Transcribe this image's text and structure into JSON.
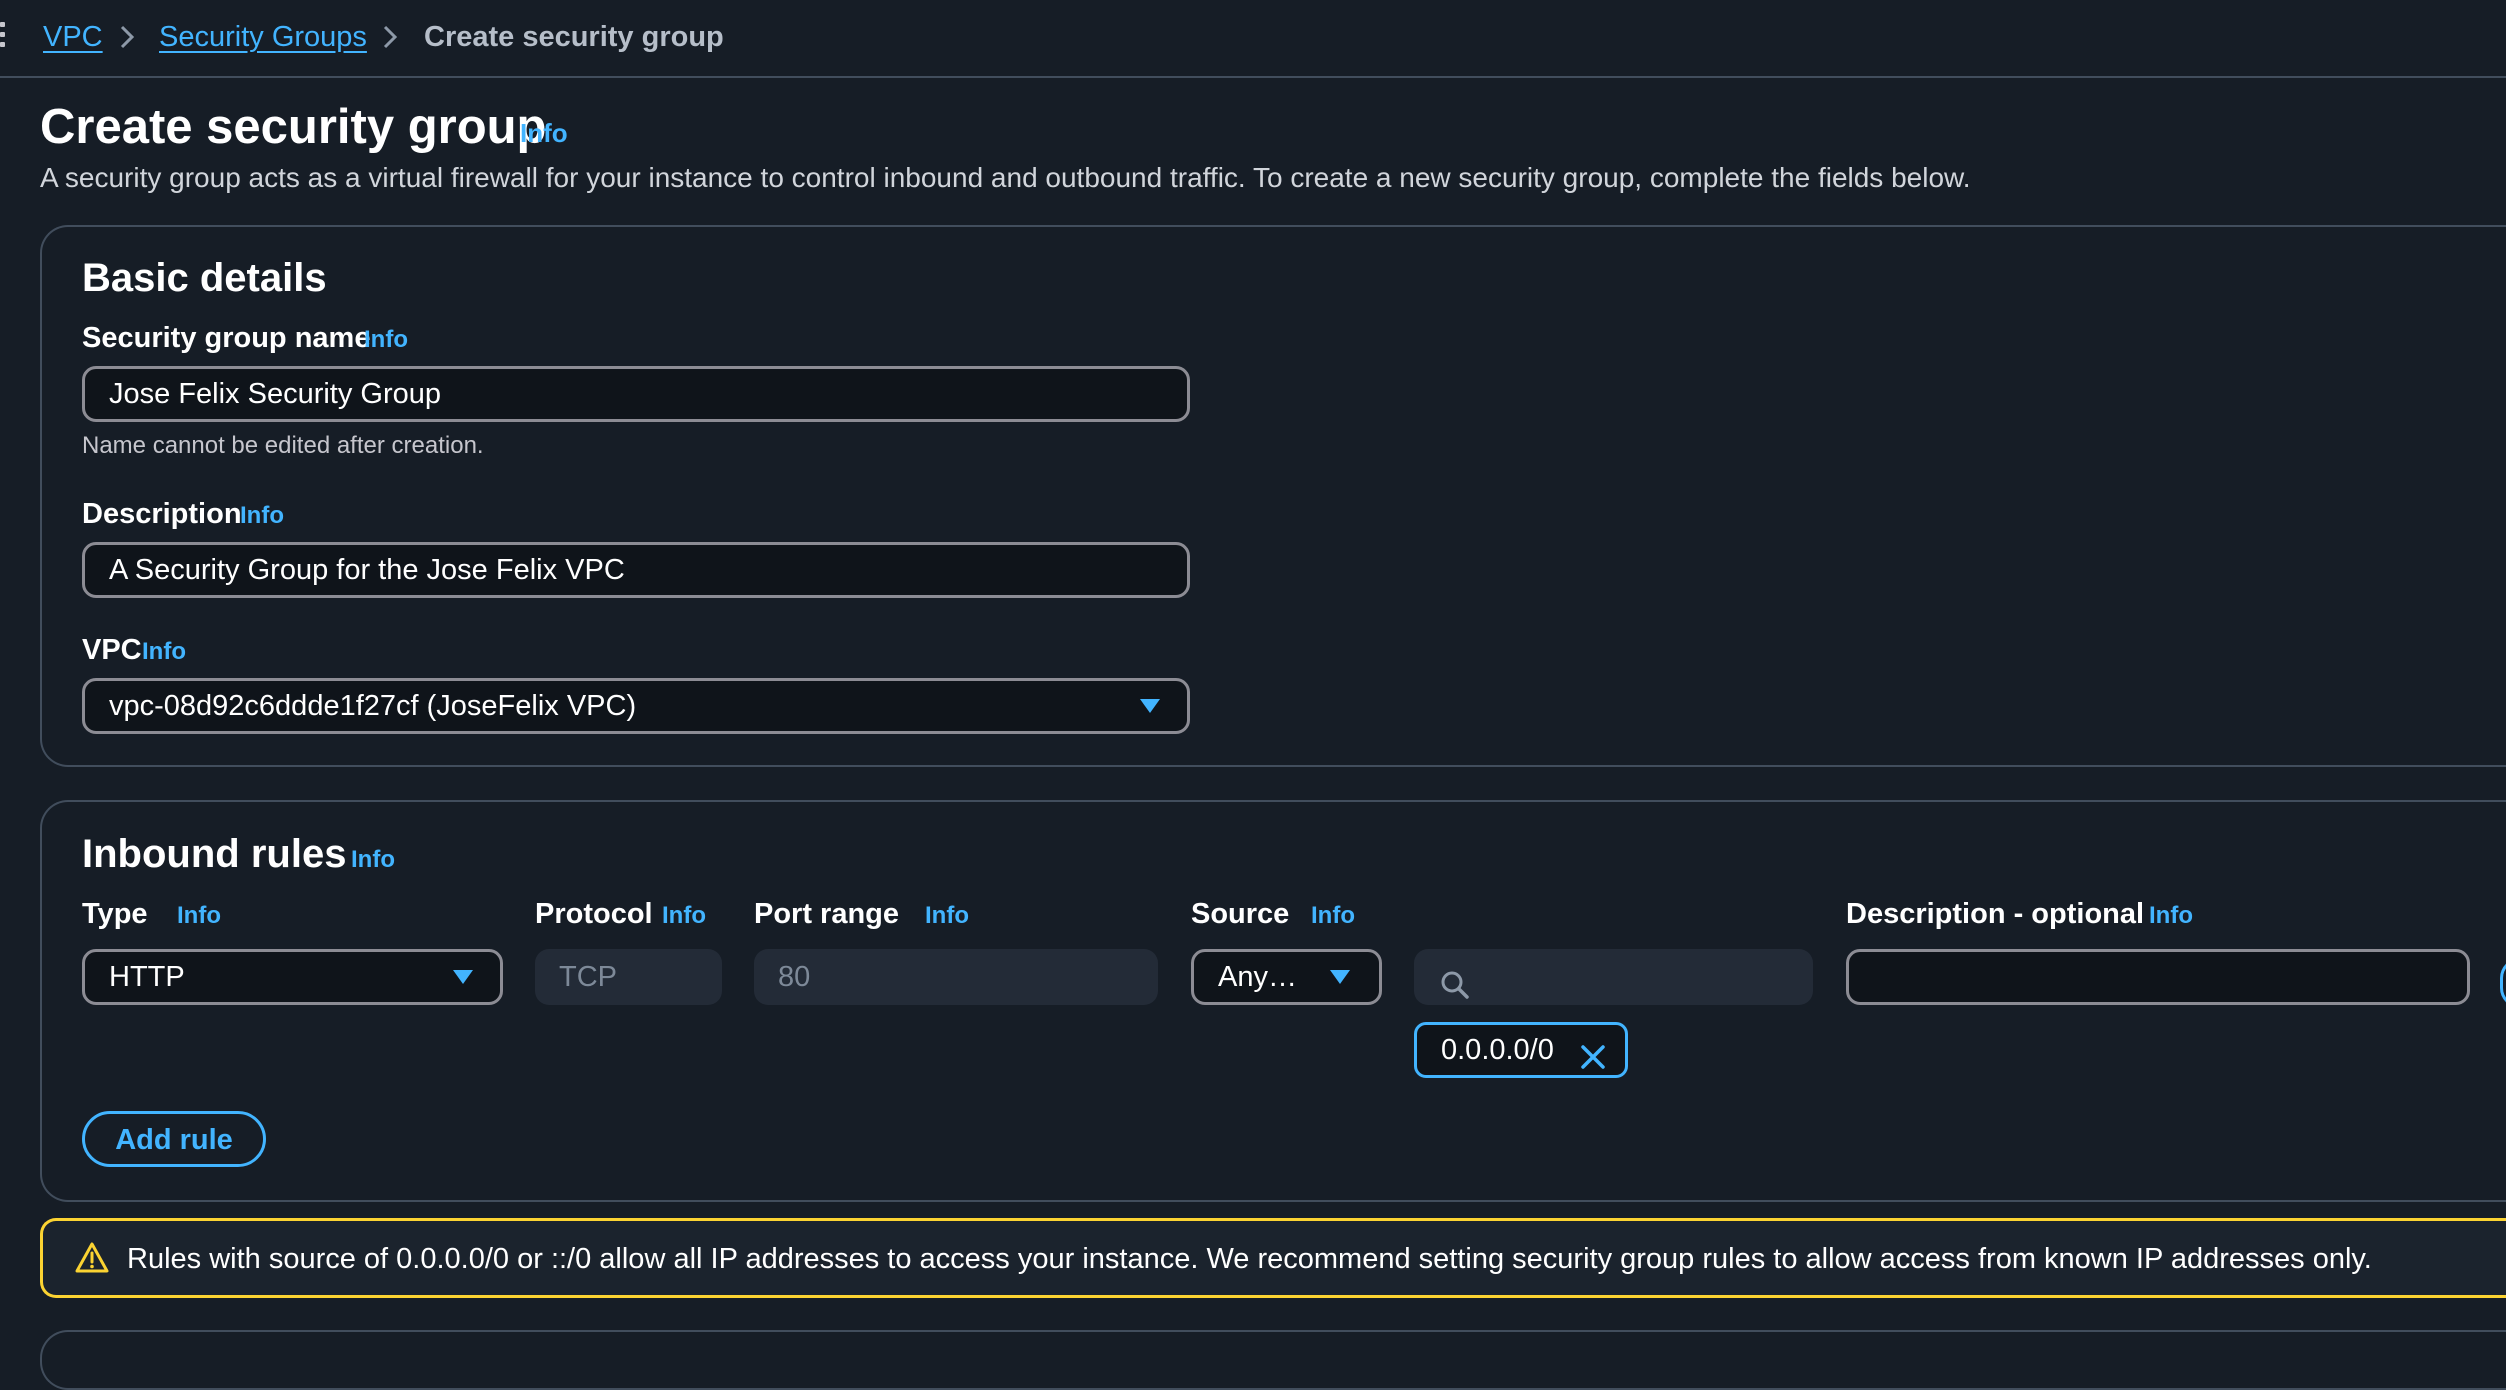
{
  "breadcrumb": {
    "items": [
      "VPC",
      "Security Groups"
    ],
    "current": "Create security group"
  },
  "header": {
    "title": "Create security group",
    "info": "Info",
    "description": "A security group acts as a virtual firewall for your instance to control inbound and outbound traffic. To create a new security group, complete the fields below."
  },
  "basic_details": {
    "heading": "Basic details",
    "name": {
      "label": "Security group name",
      "info": "Info",
      "value": "Jose Felix Security Group",
      "hint": "Name cannot be edited after creation."
    },
    "description": {
      "label": "Description",
      "info": "Info",
      "value": "A Security Group for the Jose Felix VPC"
    },
    "vpc": {
      "label": "VPC",
      "info": "Info",
      "value": "vpc-08d92c6ddde1f27cf (JoseFelix VPC)"
    }
  },
  "inbound_rules": {
    "heading": "Inbound rules",
    "info": "Info",
    "columns": {
      "type": "Type",
      "protocol": "Protocol",
      "port_range": "Port range",
      "source": "Source",
      "description": "Description - optional",
      "info": "Info"
    },
    "rules": [
      {
        "type": "HTTP",
        "protocol": "TCP",
        "port_range": "80",
        "source_type": "Any…",
        "source_search": "",
        "source_token": "0.0.0.0/0",
        "description": ""
      }
    ],
    "add_rule_label": "Add rule"
  },
  "warning": {
    "text": "Rules with source of 0.0.0.0/0 or ::/0 allow all IP addresses to access your instance. We recommend setting security group rules to allow access from known IP addresses only."
  },
  "colors": {
    "background": "#161d26",
    "link": "#42b4ff",
    "border": "#414d5c",
    "warning": "#fbd332"
  },
  "icons": {
    "menu": "menu-dots-icon",
    "breadcrumb_separator": "chevron-right-icon",
    "dropdown": "caret-down-icon",
    "search": "search-icon",
    "remove_token": "close-icon",
    "warning": "warning-triangle-icon"
  }
}
